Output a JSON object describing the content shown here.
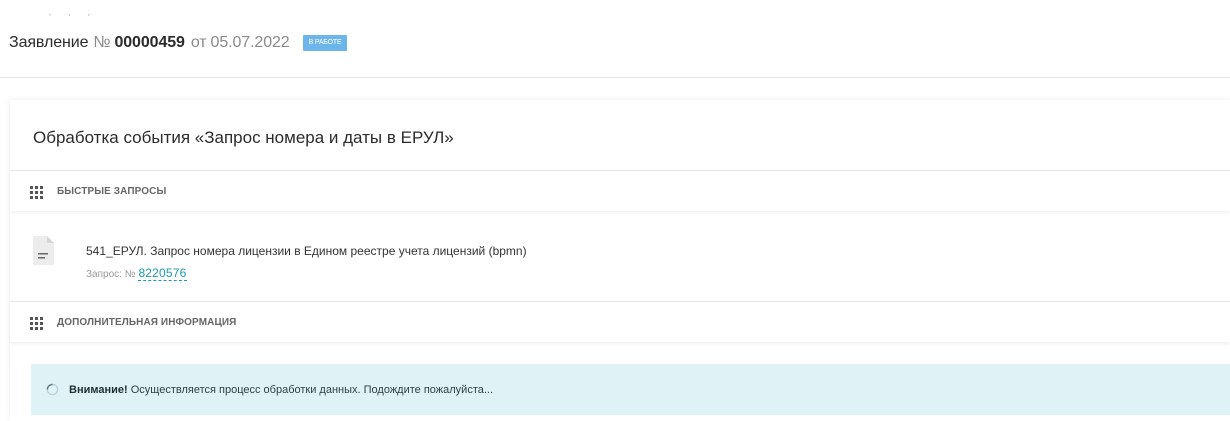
{
  "header": {
    "title_word": "Заявление",
    "number_sign": "№",
    "number": "00000459",
    "from_word": "от",
    "date": "05.07.2022",
    "status_badge": "В РАБОТЕ"
  },
  "panel": {
    "title": "Обработка события «Запрос номера и даты в ЕРУЛ»",
    "sections": {
      "quick_requests": {
        "label": "БЫСТРЫЕ ЗАПРОСЫ",
        "icon": "grid-icon"
      },
      "additional_info": {
        "label": "ДОПОЛНИТЕЛЬНАЯ ИНФОРМАЦИЯ",
        "icon": "grid-icon"
      }
    },
    "request": {
      "icon": "document-icon",
      "name": "541_ЕРУЛ. Запрос номера лицензии в Едином реестре учета лицензий (bpmn)",
      "sub_label": "Запрос: №",
      "number": "8220576"
    },
    "alert": {
      "icon": "spinner-icon",
      "strong": "Внимание!",
      "message": " Осуществляется процесс обработки данных. Подождите пожалуйста..."
    }
  },
  "colors": {
    "badge": "#6cb5ea",
    "link": "#1a9bb3",
    "alert_bg": "#dff3f6"
  }
}
